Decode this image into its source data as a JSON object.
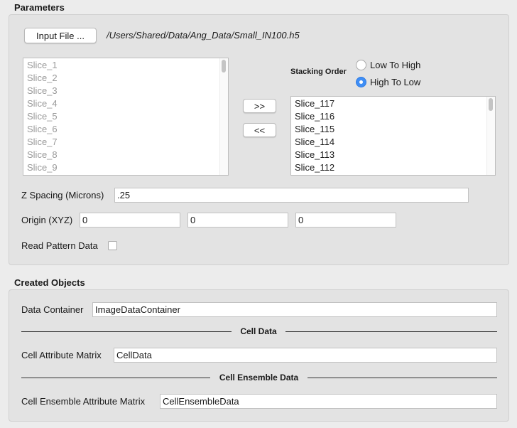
{
  "parameters": {
    "title": "Parameters",
    "input_file_button": "Input File ...",
    "input_file_path": "/Users/Shared/Data/Ang_Data/Small_IN100.h5",
    "available_slices": [
      "Slice_1",
      "Slice_2",
      "Slice_3",
      "Slice_4",
      "Slice_5",
      "Slice_6",
      "Slice_7",
      "Slice_8",
      "Slice_9"
    ],
    "add_button": ">>",
    "remove_button": "<<",
    "stacking_order_label": "Stacking Order",
    "stacking_options": [
      {
        "label": "Low To High",
        "checked": false
      },
      {
        "label": "High To Low",
        "checked": true
      }
    ],
    "selected_slices": [
      "Slice_117",
      "Slice_116",
      "Slice_115",
      "Slice_114",
      "Slice_113",
      "Slice_112"
    ],
    "z_spacing_label": "Z Spacing (Microns)",
    "z_spacing_value": ".25",
    "origin_label": "Origin (XYZ)",
    "origin_values": [
      "0",
      "0",
      "0"
    ],
    "read_pattern_label": "Read Pattern Data",
    "read_pattern_checked": false
  },
  "created_objects": {
    "title": "Created Objects",
    "data_container_label": "Data Container",
    "data_container_value": "ImageDataContainer",
    "cell_data_divider": "Cell Data",
    "cell_attribute_matrix_label": "Cell Attribute Matrix",
    "cell_attribute_matrix_value": "CellData",
    "cell_ensemble_divider": "Cell Ensemble Data",
    "cell_ensemble_matrix_label": "Cell Ensemble Attribute Matrix",
    "cell_ensemble_matrix_value": "CellEnsembleData"
  },
  "colors": {
    "radio_selected": "#3f8ef5",
    "background": "#ececec",
    "group_background": "#e3e3e3"
  }
}
